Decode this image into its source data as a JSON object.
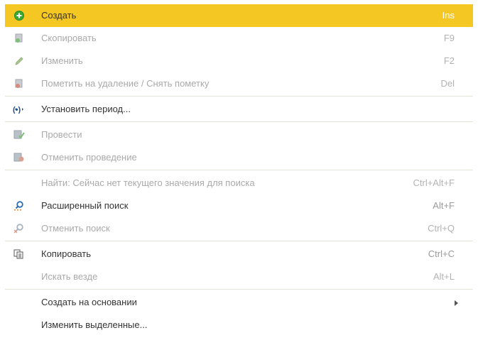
{
  "menu": {
    "create": {
      "label": "Создать",
      "shortcut": "Ins",
      "icon": "plus-circle-icon"
    },
    "copy_item": {
      "label": "Скопировать",
      "shortcut": "F9",
      "icon": "copy-document-icon"
    },
    "edit": {
      "label": "Изменить",
      "shortcut": "F2",
      "icon": "pencil-icon"
    },
    "mark_delete": {
      "label": "Пометить на удаление / Снять пометку",
      "shortcut": "Del",
      "icon": "delete-mark-icon"
    },
    "set_period": {
      "label": "Установить период...",
      "icon": "period-arrows-icon"
    },
    "post": {
      "label": "Провести",
      "icon": "post-document-icon"
    },
    "unpost": {
      "label": "Отменить проведение",
      "icon": "unpost-document-icon"
    },
    "find": {
      "label": "Найти: Сейчас нет текущего значения для поиска",
      "shortcut": "Ctrl+Alt+F"
    },
    "advanced_search": {
      "label": "Расширенный поиск",
      "shortcut": "Alt+F",
      "icon": "search-icon"
    },
    "cancel_search": {
      "label": "Отменить поиск",
      "shortcut": "Ctrl+Q",
      "icon": "cancel-search-icon"
    },
    "copy": {
      "label": "Копировать",
      "shortcut": "Ctrl+C",
      "icon": "copy-icon"
    },
    "search_everywhere": {
      "label": "Искать везде",
      "shortcut": "Alt+L"
    },
    "create_based_on": {
      "label": "Создать на основании",
      "icon": "submenu-arrow-icon"
    },
    "edit_selected": {
      "label": "Изменить выделенные..."
    }
  },
  "colors": {
    "highlight": "#f5c722",
    "accent_green": "#3aa935",
    "search_blue": "#2a6fb2"
  }
}
